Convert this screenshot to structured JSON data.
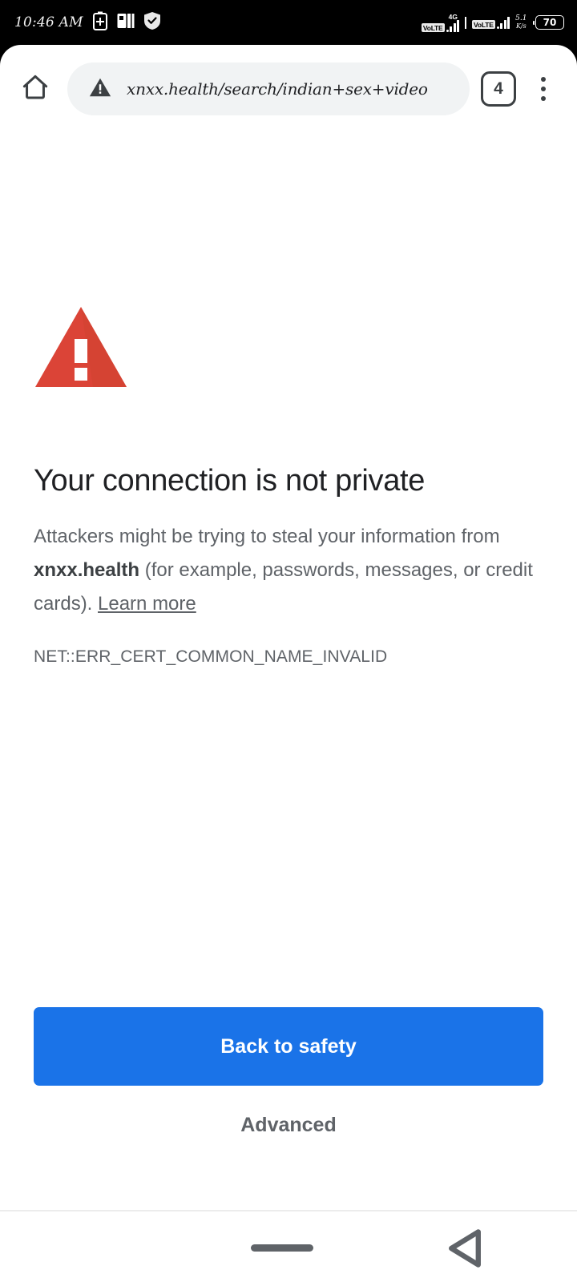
{
  "statusbar": {
    "clock": "10:46 AM",
    "left_icons": [
      "battery-saver-icon",
      "picture-in-picture-icon",
      "security-shield-icon"
    ],
    "sim1_volte": "VoLTE",
    "sim1_network": "4G",
    "sim2_volte": "VoLTE",
    "net_speed_value": "5.1",
    "net_speed_unit": "K/s",
    "battery_level": "70"
  },
  "toolbar": {
    "home_label": "Home",
    "url": "xnxx.health/search/indian+sex+video",
    "security_state": "not-secure",
    "tab_count": "4",
    "menu_label": "More options"
  },
  "interstitial": {
    "icon": "warning-triangle-icon",
    "icon_color": "#db4437",
    "title": "Your connection is not private",
    "body_part1": "Attackers might be trying to steal your information from ",
    "body_domain": "xnxx.health",
    "body_part2": " (for example, passwords, messages, or credit cards). ",
    "learn_more": "Learn more",
    "error_code": "NET::ERR_CERT_COMMON_NAME_INVALID",
    "primary_button": "Back to safety",
    "advanced_button": "Advanced",
    "primary_button_color": "#1a73e8"
  },
  "navbar": {
    "home_label": "Home gesture bar",
    "back_label": "Back"
  }
}
